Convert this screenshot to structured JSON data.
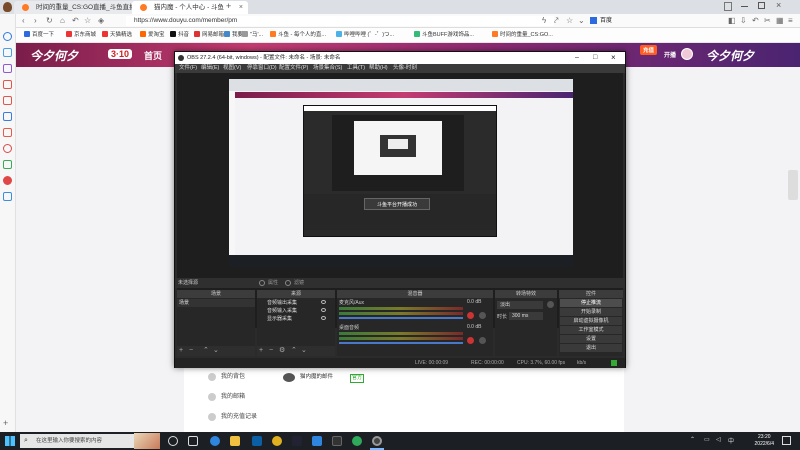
{
  "browser": {
    "tabs": [
      {
        "label": "时间的重量_CS:GO直播_斗鱼直播",
        "close": "×"
      },
      {
        "label": "猫内魔 - 个人中心 - 斗鱼",
        "close": "×"
      }
    ],
    "new_tab": "+",
    "url": "https://www.douyu.com/member/pm",
    "search_engine": "百度",
    "bookmarks": [
      "百度一下",
      "京东商城",
      "天猫精选",
      "爱淘宝",
      "抖音",
      "网易邮箱",
      "我要",
      "\"马'...",
      "斗鱼 - 每个人的直...",
      "哔哩哔哩 (゜-゜)つ...",
      "斗鱼BUFF游戏饰品...",
      "时间的重量_CS:GO..."
    ]
  },
  "douyu": {
    "banner_left": "今夕何夕",
    "banner_badge": "3·10",
    "home": "首页",
    "recharge": "充值",
    "banner_right": "今夕何夕",
    "open_live": "开播",
    "menu_items": [
      "我的背包",
      "我的邮箱",
      "我的充值记录"
    ],
    "chat_user": "猫内魔的邮件",
    "chat_tag": "官方"
  },
  "obs": {
    "title": "OBS 27.2.4 (64-bit, windows) - 配置文件: 未命名 - 场景: 未命名",
    "menu": [
      "文件(F)",
      "编辑(E)",
      "视图(V)",
      "停靠窗口(D)",
      "配置文件(P)",
      "场景集合(S)",
      "工具(T)",
      "帮助(H)",
      "头像-时刻"
    ],
    "no_source": "未选择源",
    "properties": "属性",
    "filters": "滤镜",
    "panels": {
      "scenes": "场景",
      "sources": "来源",
      "mixer": "混音器",
      "transitions": "转场特效",
      "controls": "控件"
    },
    "scene_list": [
      "场景"
    ],
    "source_list": [
      "音频输出采集",
      "音频输入采集",
      "显示器采集"
    ],
    "mixer_tracks": [
      {
        "name": "桌面音频",
        "db": "0.0 dB"
      },
      {
        "name": "麦克风/Aux",
        "db": "0.0 dB"
      }
    ],
    "transition_type": "淡出",
    "duration_label": "时长",
    "duration": "300 ms",
    "controls": [
      "停止推流",
      "开始录制",
      "启动虚拟摄像机",
      "工作室模式",
      "设置",
      "退出"
    ],
    "nested_notice": "斗鱼平台开播成功",
    "status": {
      "live": "LIVE: 00:00:09",
      "rec": "REC: 00:00:00",
      "cpu": "CPU: 3.7%, 60.00 fps",
      "kbps": "kb/s"
    }
  },
  "taskbar": {
    "search_placeholder": "在这里输入你要搜索的内容",
    "time": "23:20",
    "date": "2022/6/4"
  },
  "colors": {
    "douyu_orange": "#ff5d23",
    "obs_bg": "#2b2b2b",
    "banner_magenta": "#c43c71",
    "active_control": "#4d4d4d"
  }
}
